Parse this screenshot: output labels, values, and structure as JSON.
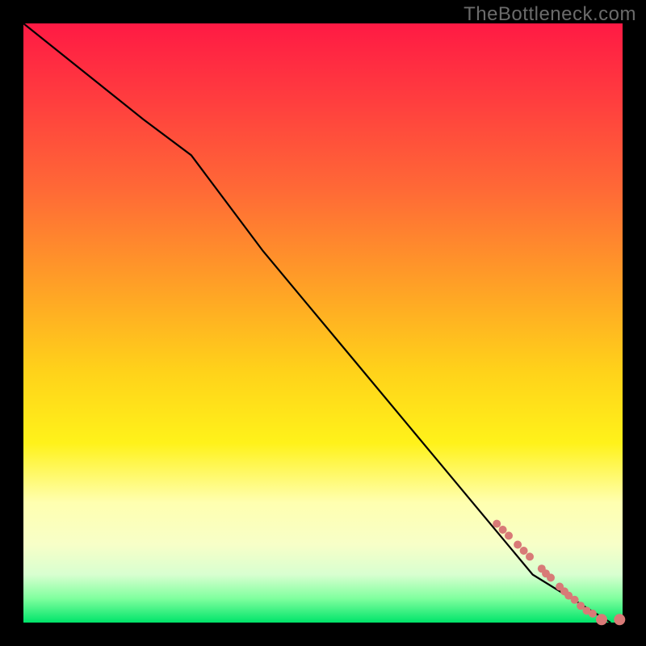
{
  "watermark": "TheBottleneck.com",
  "chart_data": {
    "type": "line",
    "title": "",
    "xlabel": "",
    "ylabel": "",
    "xlim": [
      0,
      100
    ],
    "ylim": [
      0,
      100
    ],
    "background_gradient": [
      "#ff1a44",
      "#ff6a36",
      "#ffd21a",
      "#ffffb0",
      "#00e46a"
    ],
    "series": [
      {
        "name": "curve",
        "color": "#000000",
        "x": [
          0,
          10,
          20,
          28,
          40,
          55,
          70,
          85,
          98
        ],
        "y": [
          100,
          92,
          84,
          78,
          62,
          44,
          26,
          8,
          0
        ]
      }
    ],
    "markers": {
      "name": "highlight-points",
      "color": "#d87a77",
      "radius_small": 5,
      "radius_large": 7,
      "points_xy": [
        [
          79,
          16.5
        ],
        [
          80,
          15.5
        ],
        [
          81,
          14.5
        ],
        [
          82.5,
          13
        ],
        [
          83.5,
          12
        ],
        [
          84.5,
          11
        ],
        [
          86.5,
          9
        ],
        [
          87.2,
          8.2
        ],
        [
          88,
          7.5
        ],
        [
          89.5,
          6
        ],
        [
          90.3,
          5.2
        ],
        [
          91,
          4.5
        ],
        [
          92,
          3.8
        ],
        [
          93,
          2.8
        ],
        [
          94,
          2
        ],
        [
          95,
          1.5
        ],
        [
          96.5,
          0.5
        ],
        [
          99.5,
          0.5
        ]
      ],
      "large_indices": [
        16,
        17
      ]
    }
  }
}
